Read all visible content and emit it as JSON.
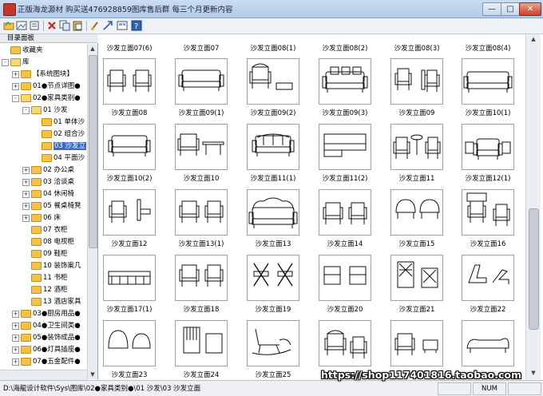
{
  "window": {
    "title": "正版海龙源材 购买送476928859图库售后群 每三个月更新内容",
    "icon": "app-icon",
    "controls": {
      "minimize": "—",
      "maximize": "□",
      "close": "✕"
    }
  },
  "toolbar": {
    "buttons": [
      "open-folder-icon",
      "image-icon",
      "list-icon",
      "delete-icon",
      "copy-icon",
      "paste-icon",
      "brush-icon",
      "export-icon",
      "view-icon",
      "help-icon"
    ]
  },
  "sidebar": {
    "header": "目录面板",
    "tree": [
      {
        "label": "收藏夹",
        "level": 0,
        "exp": "",
        "open": false
      },
      {
        "label": "库",
        "level": 0,
        "exp": "-",
        "open": true
      },
      {
        "label": "【系统图块】",
        "level": 1,
        "exp": "+",
        "open": false
      },
      {
        "label": "01●节点详图●",
        "level": 1,
        "exp": "+",
        "open": false
      },
      {
        "label": "02●家具类别●",
        "level": 1,
        "exp": "-",
        "open": true
      },
      {
        "label": "01 沙发",
        "level": 2,
        "exp": "-",
        "open": true
      },
      {
        "label": "01 单体沙",
        "level": 3,
        "exp": "",
        "open": false
      },
      {
        "label": "02 组合沙",
        "level": 3,
        "exp": "",
        "open": false
      },
      {
        "label": "03 沙发立",
        "level": 3,
        "exp": "",
        "open": false,
        "selected": true
      },
      {
        "label": "04 平面沙",
        "level": 3,
        "exp": "",
        "open": false
      },
      {
        "label": "02 办公桌",
        "level": 2,
        "exp": "+",
        "open": false
      },
      {
        "label": "03 洽谈桌",
        "level": 2,
        "exp": "+",
        "open": false
      },
      {
        "label": "04 休闲椅",
        "level": 2,
        "exp": "+",
        "open": false
      },
      {
        "label": "05 餐桌椅凳",
        "level": 2,
        "exp": "+",
        "open": false
      },
      {
        "label": "06 床",
        "level": 2,
        "exp": "+",
        "open": false
      },
      {
        "label": "07 衣柜",
        "level": 2,
        "exp": "",
        "open": false
      },
      {
        "label": "08 电视柜",
        "level": 2,
        "exp": "",
        "open": false
      },
      {
        "label": "09 鞋柜",
        "level": 2,
        "exp": "",
        "open": false
      },
      {
        "label": "10 装饰案几",
        "level": 2,
        "exp": "",
        "open": false
      },
      {
        "label": "11 书柜",
        "level": 2,
        "exp": "",
        "open": false
      },
      {
        "label": "12 酒柜",
        "level": 2,
        "exp": "",
        "open": false
      },
      {
        "label": "13 酒店家具",
        "level": 2,
        "exp": "",
        "open": false
      },
      {
        "label": "03●厨房用品●",
        "level": 1,
        "exp": "+",
        "open": false
      },
      {
        "label": "04●卫生间类●",
        "level": 1,
        "exp": "+",
        "open": false
      },
      {
        "label": "05●装饰成品●",
        "level": 1,
        "exp": "+",
        "open": false
      },
      {
        "label": "06●灯具插座●",
        "level": 1,
        "exp": "+",
        "open": false
      },
      {
        "label": "07●五金配件●",
        "level": 1,
        "exp": "+",
        "open": false
      }
    ]
  },
  "thumbnails": {
    "top_captions": [
      "沙发立面07(6)",
      "沙发立面07",
      "沙发立面08(1)",
      "沙发立面08(2)",
      "沙发立面08(3)",
      "沙发立面08(4)"
    ],
    "rows": [
      [
        "沙发立面08",
        "沙发立面09(1)",
        "沙发立面09(2)",
        "沙发立面09(3)",
        "沙发立面09",
        "沙发立面10(1)"
      ],
      [
        "沙发立面10(2)",
        "沙发立面10",
        "沙发立面11(1)",
        "沙发立面11(2)",
        "沙发立面11",
        "沙发立面12(1)"
      ],
      [
        "沙发立面12",
        "沙发立面13(1)",
        "沙发立面13",
        "沙发立面14",
        "沙发立面15",
        "沙发立面16"
      ],
      [
        "沙发立面17(1)",
        "沙发立面18",
        "沙发立面19",
        "沙发立面20",
        "沙发立面21",
        "沙发立面22"
      ],
      [
        "沙发立面23",
        "沙发立面24",
        "沙发立面25",
        "",
        "",
        ""
      ]
    ],
    "drawings": [
      [
        "two-chairs",
        "sofa",
        "armchair-ottoman",
        "sofa-cushions",
        "two-chairs-b",
        "long-sofa"
      ],
      [
        "loveseat",
        "chair-table",
        "chesterfield",
        "sectional",
        "chairs-table",
        "sofa-set"
      ],
      [
        "chair-pair",
        "chair-pair-b",
        "camelback",
        "chairs-arms",
        "chairs-round",
        "wingchair-pair"
      ],
      [
        "daybed",
        "chair-pair-c",
        "x-chairs",
        "chairs-box",
        "chair-lattice",
        "lounge-chair"
      ],
      [
        "tub-chairs",
        "slat-chair",
        "rocker",
        "armchair-wide",
        "armchair-side",
        "chaise"
      ]
    ]
  },
  "statusbar": {
    "path": "D:\\海龍设计软件\\Sys\\图库\\02●家具类别●\\01 沙发\\03 沙发立面",
    "cells": [
      "",
      "NUM",
      ""
    ]
  },
  "watermark": "https://shop117401816.taobao.com"
}
